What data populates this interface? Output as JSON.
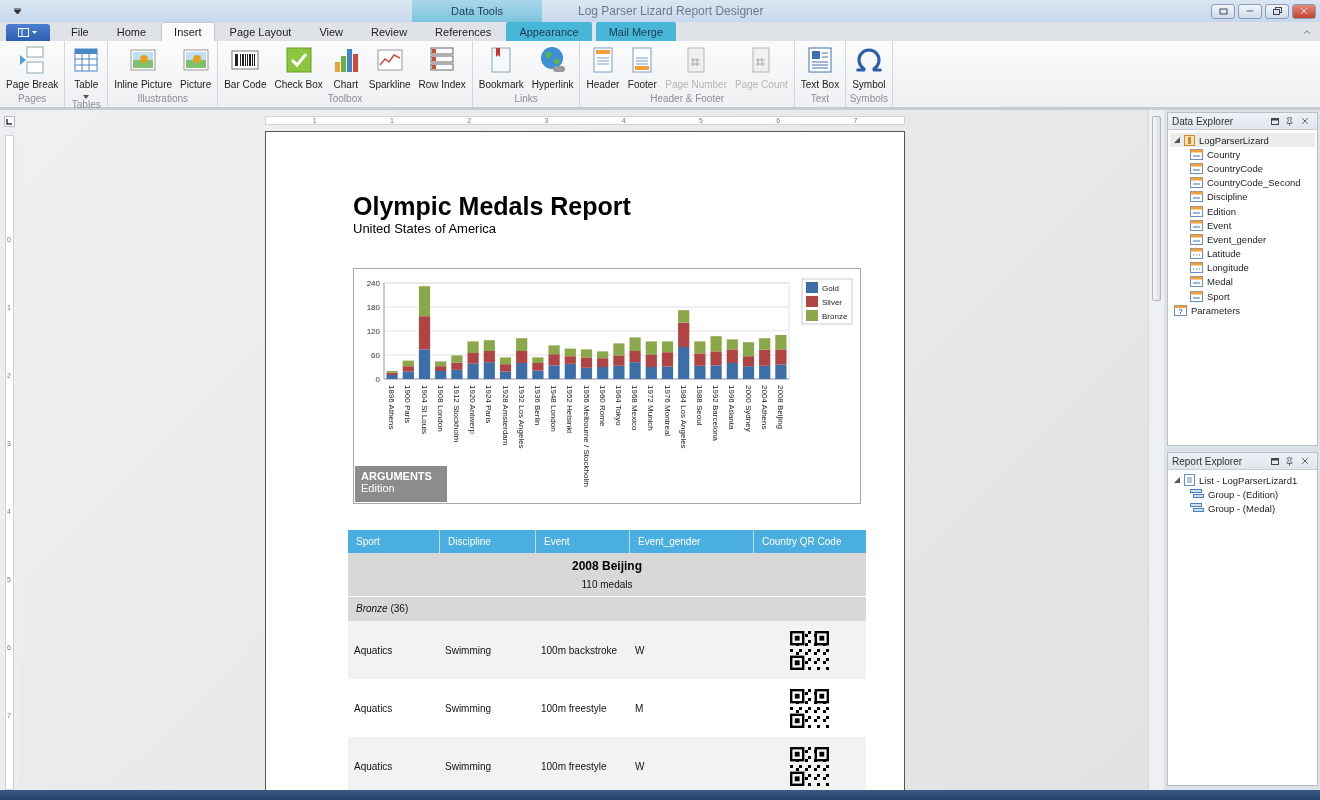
{
  "window": {
    "title": "Log Parser Lizard Report Designer",
    "contextual_header": "Data Tools"
  },
  "tabs": [
    {
      "label": "File",
      "kind": "normal",
      "selected": false
    },
    {
      "label": "Home",
      "kind": "normal",
      "selected": false
    },
    {
      "label": "Insert",
      "kind": "normal",
      "selected": true
    },
    {
      "label": "Page Layout",
      "kind": "normal",
      "selected": false
    },
    {
      "label": "View",
      "kind": "normal",
      "selected": false
    },
    {
      "label": "Review",
      "kind": "normal",
      "selected": false
    },
    {
      "label": "References",
      "kind": "normal",
      "selected": false
    },
    {
      "label": "Appearance",
      "kind": "contextual",
      "selected": false
    },
    {
      "label": "Mail Merge",
      "kind": "contextual",
      "selected": false
    }
  ],
  "ribbon_groups": [
    {
      "label": "Pages",
      "buttons": [
        {
          "label": "Page Break",
          "disabled": false
        }
      ]
    },
    {
      "label": "Tables",
      "buttons": [
        {
          "label": "Table",
          "disabled": false,
          "dropdown": true
        }
      ]
    },
    {
      "label": "Illustrations",
      "buttons": [
        {
          "label": "Inline Picture",
          "disabled": false
        },
        {
          "label": "Picture",
          "disabled": false
        }
      ]
    },
    {
      "label": "Toolbox",
      "buttons": [
        {
          "label": "Bar Code",
          "disabled": false
        },
        {
          "label": "Check Box",
          "disabled": false
        },
        {
          "label": "Chart",
          "disabled": false
        },
        {
          "label": "Sparkline",
          "disabled": false
        },
        {
          "label": "Row Index",
          "disabled": false
        }
      ]
    },
    {
      "label": "Links",
      "buttons": [
        {
          "label": "Bookmark",
          "disabled": false
        },
        {
          "label": "Hyperlink",
          "disabled": false
        }
      ]
    },
    {
      "label": "Header & Footer",
      "buttons": [
        {
          "label": "Header",
          "disabled": false
        },
        {
          "label": "Footer",
          "disabled": false
        },
        {
          "label": "Page Number",
          "disabled": true
        },
        {
          "label": "Page Count",
          "disabled": true
        }
      ]
    },
    {
      "label": "Text",
      "buttons": [
        {
          "label": "Text Box",
          "disabled": false
        }
      ]
    },
    {
      "label": "Symbols",
      "buttons": [
        {
          "label": "Symbol",
          "disabled": false
        }
      ]
    }
  ],
  "rulers": {
    "horizontal": [
      "1",
      "1",
      "2",
      "3",
      "4",
      "5",
      "6",
      "7"
    ],
    "vertical": [
      "0",
      "1",
      "2",
      "3",
      "4",
      "5",
      "6",
      "7"
    ]
  },
  "report": {
    "title": "Olympic Medals Report",
    "subtitle": "United States of America",
    "chart": {
      "argument_title": "ARGUMENTS",
      "argument_value": "Edition",
      "chart_data": {
        "type": "bar",
        "stacked": true,
        "orientation": "vertical",
        "categories": [
          "1896 Athens",
          "1900 Paris",
          "1904 St Louis",
          "1908 London",
          "1912 Stockholm",
          "1920 Antwerp",
          "1924 Paris",
          "1928 Amsterdam",
          "1932 Los Angeles",
          "1936 Berlin",
          "1948 London",
          "1952 Helsinki",
          "1956 Melbourne / Stockholm",
          "1960 Rome",
          "1964 Tokyo",
          "1968 Mexico",
          "1972 Munich",
          "1976 Montreal",
          "1984 Los Angeles",
          "1988 Seoul",
          "1992 Barcelona",
          "1996 Atlanta",
          "2000 Sydney",
          "2004 Athens",
          "2008 Beijing"
        ],
        "series": [
          {
            "name": "Gold",
            "color": "#3d6ea8",
            "values": [
              10,
              19,
              74,
              20,
              23,
              39,
              42,
              19,
              40,
              21,
              34,
              38,
              28,
              30,
              33,
              42,
              30,
              31,
              80,
              33,
              34,
              40,
              32,
              33,
              36
            ]
          },
          {
            "name": "Silver",
            "color": "#b04343",
            "values": [
              6,
              13,
              83,
              12,
              18,
              26,
              28,
              18,
              30,
              19,
              28,
              19,
              26,
              22,
              26,
              28,
              30,
              36,
              61,
              31,
              35,
              34,
              25,
              40,
              38
            ]
          },
          {
            "name": "Bronze",
            "color": "#8aa84a",
            "values": [
              4,
              14,
              75,
              12,
              18,
              29,
              27,
              17,
              32,
              14,
              22,
              19,
              20,
              17,
              30,
              34,
              34,
              27,
              31,
              30,
              38,
              25,
              35,
              29,
              36
            ]
          }
        ],
        "ylim": [
          0,
          240
        ],
        "yticks": [
          0,
          60,
          120,
          180,
          240
        ],
        "grid": true,
        "legend": true
      }
    },
    "table": {
      "columns": [
        "Sport",
        "Discipline",
        "Event",
        "Event_gender",
        "Country QR Code"
      ],
      "group": {
        "title": "2008 Beijing",
        "subtitle": "110 medals"
      },
      "subgroup": "*Bronze* (36)",
      "rows": [
        [
          "Aquatics",
          "Swimming",
          "100m backstroke",
          "W"
        ],
        [
          "Aquatics",
          "Swimming",
          "100m freestyle",
          "M"
        ],
        [
          "Aquatics",
          "Swimming",
          "100m freestyle",
          "W"
        ]
      ]
    }
  },
  "data_explorer": {
    "title": "Data Explorer",
    "tree": [
      {
        "label": "LogParserLizard",
        "kind": "source",
        "selected": true,
        "expanded": true,
        "children": [
          {
            "label": "Country",
            "kind": "text",
            "selected": false
          },
          {
            "label": "CountryCode",
            "kind": "text",
            "selected": false
          },
          {
            "label": "CountryCode_Second",
            "kind": "text",
            "selected": false
          },
          {
            "label": "Discipline",
            "kind": "text",
            "selected": false
          },
          {
            "label": "Edition",
            "kind": "text",
            "selected": false
          },
          {
            "label": "Event",
            "kind": "text",
            "selected": false
          },
          {
            "label": "Event_gender",
            "kind": "text",
            "selected": false
          },
          {
            "label": "Latitude",
            "kind": "number",
            "selected": false
          },
          {
            "label": "Longitude",
            "kind": "number",
            "selected": false
          },
          {
            "label": "Medal",
            "kind": "text",
            "selected": false
          },
          {
            "label": "Sport",
            "kind": "text",
            "selected": false
          }
        ]
      },
      {
        "label": "Parameters",
        "kind": "parameters",
        "selected": false
      }
    ]
  },
  "report_explorer": {
    "title": "Report Explorer",
    "tree": [
      {
        "label": "List - LogParserLizard1",
        "kind": "list",
        "selected": false,
        "expanded": true,
        "children": [
          {
            "label": "Group - (Edition)",
            "kind": "group",
            "selected": false
          },
          {
            "label": "Group - (Medal)",
            "kind": "group",
            "selected": false
          }
        ]
      }
    ]
  }
}
